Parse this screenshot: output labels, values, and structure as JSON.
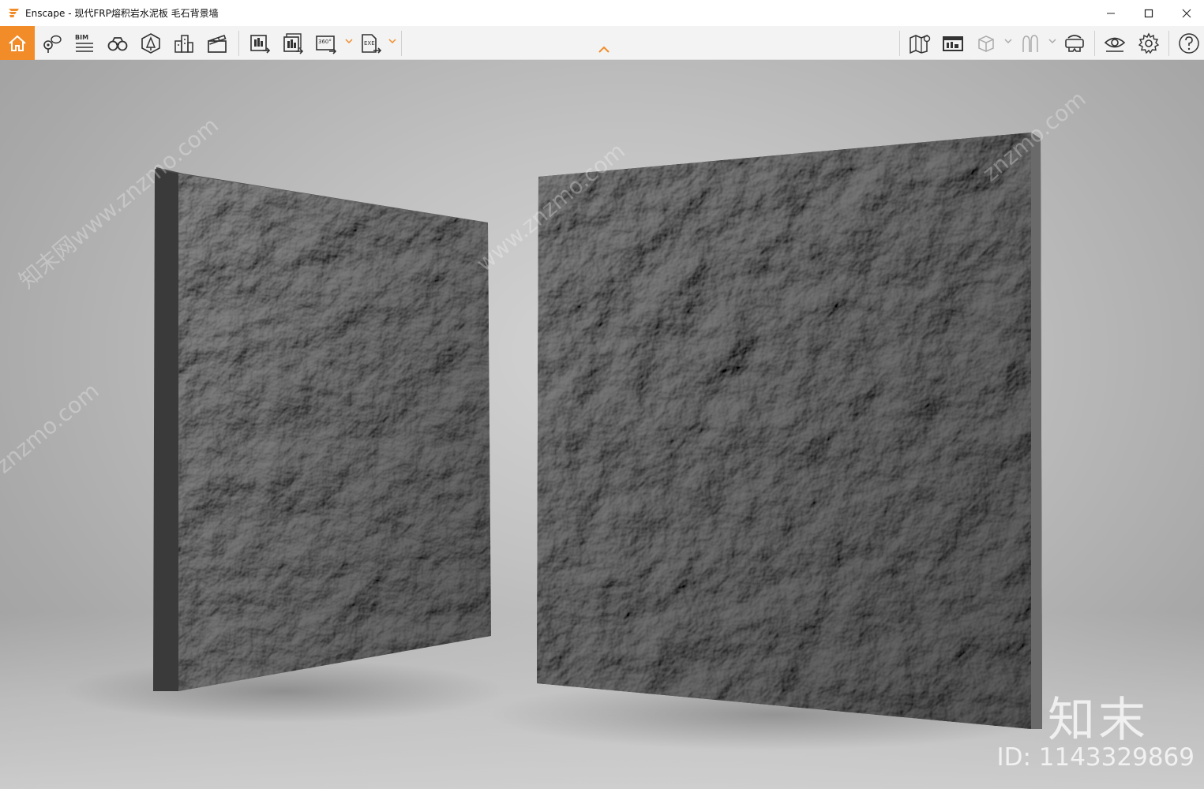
{
  "window": {
    "title": "Enscape - 现代FRP熔积岩水泥板 毛石背景墙",
    "brand_color": "#f28c28"
  },
  "toolbar": {
    "left_buttons": [
      {
        "name": "home",
        "icon": "home-icon",
        "active": true
      },
      {
        "name": "views",
        "icon": "location-pin-icon"
      },
      {
        "name": "bim",
        "icon": "bim-icon",
        "label": "BIM"
      },
      {
        "name": "binoculars",
        "icon": "binoculars-icon"
      },
      {
        "name": "asset-library",
        "icon": "asset-library-icon"
      },
      {
        "name": "buildings",
        "icon": "buildings-icon"
      },
      {
        "name": "video-editor",
        "icon": "clapperboard-icon"
      },
      {
        "name": "screenshot",
        "icon": "export-image-icon"
      },
      {
        "name": "batch-render",
        "icon": "batch-render-icon"
      },
      {
        "name": "panorama",
        "icon": "panorama-360-icon",
        "label": "360°"
      },
      {
        "name": "export-exe",
        "icon": "export-exe-icon",
        "label": "EXE"
      }
    ],
    "right_buttons": [
      {
        "name": "map",
        "icon": "map-icon"
      },
      {
        "name": "minimap",
        "icon": "minimap-icon"
      },
      {
        "name": "view-cube",
        "icon": "cube-icon"
      },
      {
        "name": "people",
        "icon": "people-icon"
      },
      {
        "name": "vr-headset",
        "icon": "vr-headset-icon"
      },
      {
        "name": "visual-settings",
        "icon": "eye-icon"
      },
      {
        "name": "settings",
        "icon": "gear-icon"
      },
      {
        "name": "help",
        "icon": "help-icon"
      }
    ]
  },
  "viewport": {
    "watermarks": [
      "知末网www.znzmo.com",
      "znzmo.com",
      "www.znzmo.com",
      "znzmo.com"
    ],
    "logo_text": "知末",
    "id_text": "ID: 1143329869"
  }
}
